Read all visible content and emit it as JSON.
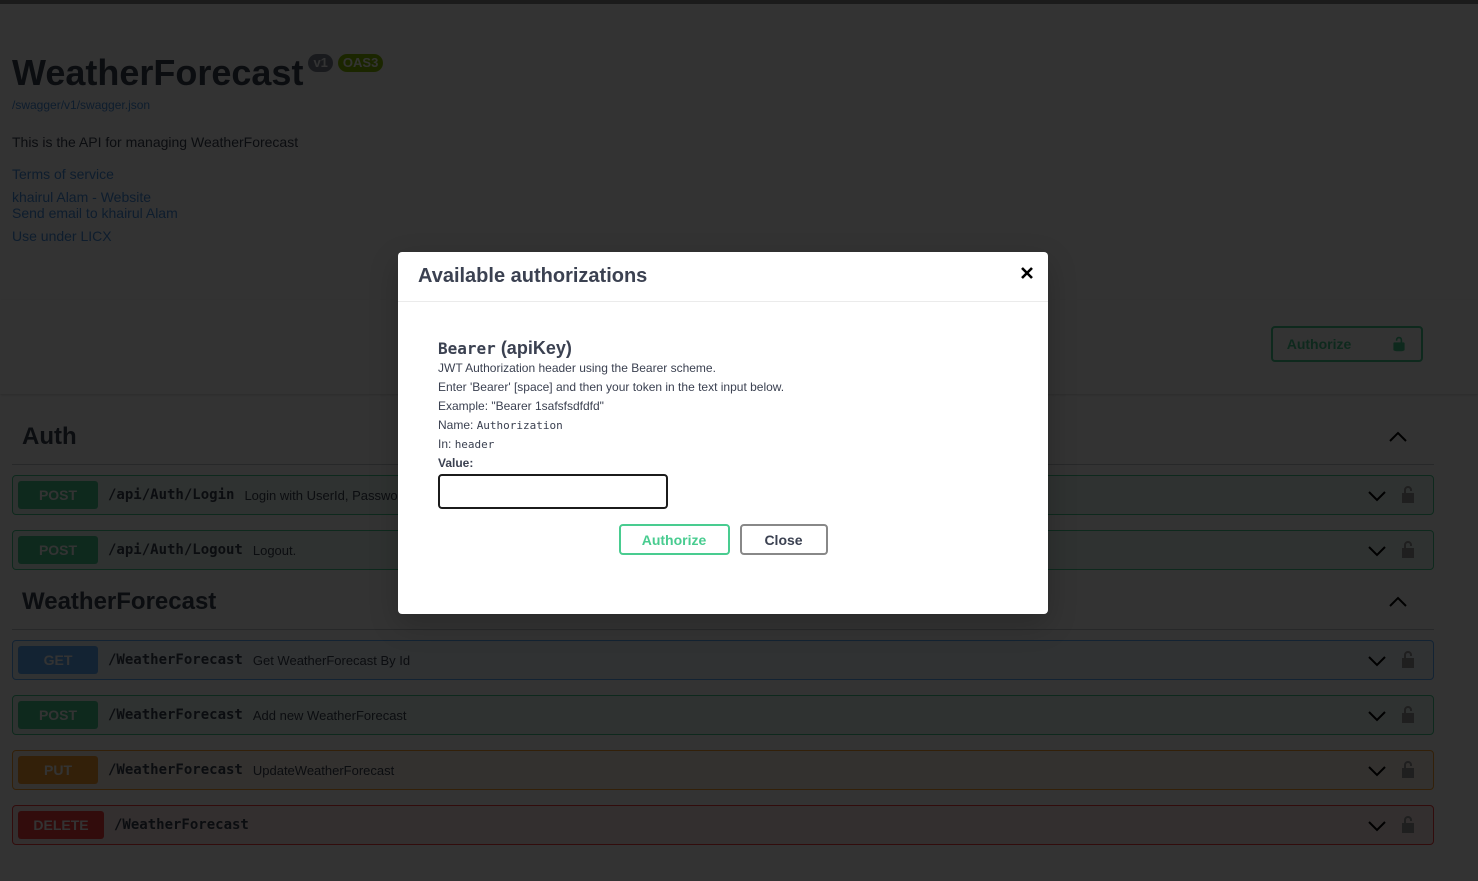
{
  "info": {
    "title": "WeatherForecast",
    "version_badge": "v1",
    "oas_badge": "OAS3",
    "spec_url": "/swagger/v1/swagger.json",
    "description": "This is the API for managing WeatherForecast",
    "links": {
      "terms": "Terms of service",
      "website": "khairul Alam - Website",
      "email": "Send email to khairul Alam",
      "license": "Use under LICX"
    }
  },
  "scheme": {
    "authorize_label": "Authorize"
  },
  "tags": [
    {
      "name": "Auth",
      "operations": [
        {
          "method": "POST",
          "path": "/api/Auth/Login",
          "summary": "Login with UserId, Password"
        },
        {
          "method": "POST",
          "path": "/api/Auth/Logout",
          "summary": "Logout."
        }
      ]
    },
    {
      "name": "WeatherForecast",
      "operations": [
        {
          "method": "GET",
          "path": "/WeatherForecast",
          "summary": "Get WeatherForecast By Id"
        },
        {
          "method": "POST",
          "path": "/WeatherForecast",
          "summary": "Add new WeatherForecast"
        },
        {
          "method": "PUT",
          "path": "/WeatherForecast",
          "summary": "UpdateWeatherForecast"
        },
        {
          "method": "DELETE",
          "path": "/WeatherForecast",
          "summary": ""
        }
      ]
    }
  ],
  "modal": {
    "title": "Available authorizations",
    "scheme_name": "Bearer",
    "scheme_type": "(apiKey)",
    "desc_lines": [
      "JWT Authorization header using the Bearer scheme.",
      "Enter 'Bearer' [space] and then your token in the text input below.",
      "Example: \"Bearer 1safsfsdfdfd\""
    ],
    "name_label": "Name:",
    "name_value": "Authorization",
    "in_label": "In:",
    "in_value": "header",
    "value_label": "Value:",
    "value": "",
    "authorize_label": "Authorize",
    "close_label": "Close"
  }
}
